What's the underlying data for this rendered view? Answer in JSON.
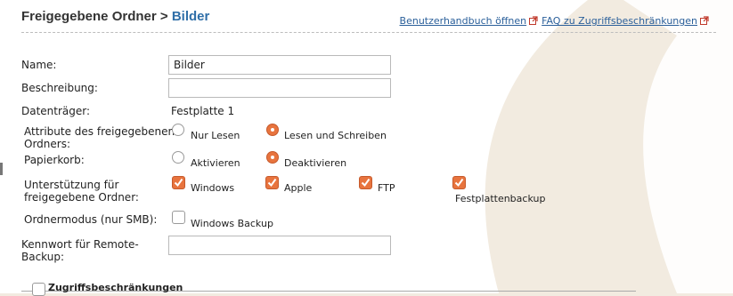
{
  "header": {
    "section": "Freigegebene Ordner",
    "separator": " > ",
    "current": "Bilder",
    "manual_link": "Benutzerhandbuch öffnen",
    "faq_link": "FAQ zu Zugriffsbeschränkungen"
  },
  "form": {
    "name_label": "Name:",
    "name_value": "Bilder",
    "description_label": "Beschreibung:",
    "description_value": "",
    "drive_label": "Datenträger:",
    "drive_value": "Festplatte 1",
    "attributes_label_1": "Attribute des freigegebenen",
    "attributes_label_2": "Ordners:",
    "attributes_options": [
      {
        "label": "Nur Lesen",
        "selected": false
      },
      {
        "label": "Lesen und Schreiben",
        "selected": true
      }
    ],
    "trash_label": "Papierkorb:",
    "trash_options": [
      {
        "label": "Aktivieren",
        "selected": false
      },
      {
        "label": "Deaktivieren",
        "selected": true
      }
    ],
    "support_label_1": "Unterstützung für",
    "support_label_2": "freigegebene Ordner:",
    "support_options": [
      {
        "label": "Windows",
        "checked": true
      },
      {
        "label": "Apple",
        "checked": true
      },
      {
        "label": "FTP",
        "checked": true
      },
      {
        "label": "Festplattenbackup",
        "checked": true
      }
    ],
    "smb_label": "Ordnermodus (nur SMB):",
    "smb_option": {
      "label": "Windows Backup",
      "checked": false
    },
    "remote_pw_label_1": "Kennwort für Remote-",
    "remote_pw_label_2": "Backup:",
    "remote_pw_value": ""
  },
  "access": {
    "label": "Zugriffsbeschränkungen",
    "checked": false
  },
  "colors": {
    "accent": "#e8743e",
    "link": "#2a5f9a",
    "title_current": "#2f6fa8"
  }
}
